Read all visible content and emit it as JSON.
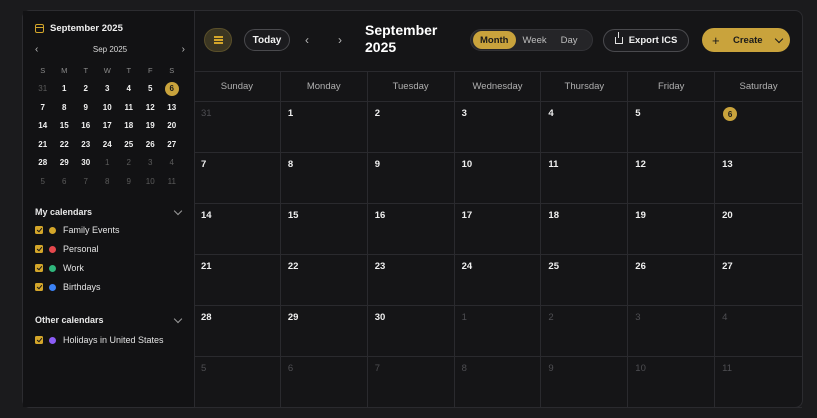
{
  "mini_calendar": {
    "title": "September 2025",
    "nav_label": "Sep 2025",
    "prev_icon": "‹",
    "next_icon": "›",
    "weekdays": [
      "S",
      "M",
      "T",
      "W",
      "T",
      "F",
      "S"
    ],
    "days": [
      {
        "d": "31",
        "out": true
      },
      {
        "d": "1"
      },
      {
        "d": "2"
      },
      {
        "d": "3"
      },
      {
        "d": "4"
      },
      {
        "d": "5"
      },
      {
        "d": "6",
        "today": true
      },
      {
        "d": "7"
      },
      {
        "d": "8"
      },
      {
        "d": "9"
      },
      {
        "d": "10"
      },
      {
        "d": "11"
      },
      {
        "d": "12"
      },
      {
        "d": "13"
      },
      {
        "d": "14"
      },
      {
        "d": "15"
      },
      {
        "d": "16"
      },
      {
        "d": "17"
      },
      {
        "d": "18"
      },
      {
        "d": "19"
      },
      {
        "d": "20"
      },
      {
        "d": "21"
      },
      {
        "d": "22"
      },
      {
        "d": "23"
      },
      {
        "d": "24"
      },
      {
        "d": "25"
      },
      {
        "d": "26"
      },
      {
        "d": "27"
      },
      {
        "d": "28"
      },
      {
        "d": "29"
      },
      {
        "d": "30"
      },
      {
        "d": "1",
        "out": true
      },
      {
        "d": "2",
        "out": true
      },
      {
        "d": "3",
        "out": true
      },
      {
        "d": "4",
        "out": true
      },
      {
        "d": "5",
        "out": true
      },
      {
        "d": "6",
        "out": true
      },
      {
        "d": "7",
        "out": true
      },
      {
        "d": "8",
        "out": true
      },
      {
        "d": "9",
        "out": true
      },
      {
        "d": "10",
        "out": true
      },
      {
        "d": "11",
        "out": true
      }
    ]
  },
  "my_calendars": {
    "heading": "My calendars",
    "items": [
      {
        "label": "Family Events",
        "color": "#d4a62a"
      },
      {
        "label": "Personal",
        "color": "#e5484d"
      },
      {
        "label": "Work",
        "color": "#2fb67c"
      },
      {
        "label": "Birthdays",
        "color": "#3b82f6"
      }
    ]
  },
  "other_calendars": {
    "heading": "Other calendars",
    "items": [
      {
        "label": "Holidays in United States",
        "color": "#8b5cf6"
      }
    ]
  },
  "toolbar": {
    "today_label": "Today",
    "prev_icon": "‹",
    "next_icon": "›",
    "title_month": "September",
    "title_year": "2025",
    "views": [
      "Month",
      "Week",
      "Day"
    ],
    "active_view": "Month",
    "export_label": "Export ICS",
    "create_label": "Create",
    "create_plus": "+"
  },
  "month_grid": {
    "weekdays": [
      "Sunday",
      "Monday",
      "Tuesday",
      "Wednesday",
      "Thursday",
      "Friday",
      "Saturday"
    ],
    "days": [
      {
        "d": "31",
        "out": true
      },
      {
        "d": "1"
      },
      {
        "d": "2"
      },
      {
        "d": "3"
      },
      {
        "d": "4"
      },
      {
        "d": "5"
      },
      {
        "d": "6",
        "today": true
      },
      {
        "d": "7"
      },
      {
        "d": "8"
      },
      {
        "d": "9"
      },
      {
        "d": "10"
      },
      {
        "d": "11"
      },
      {
        "d": "12"
      },
      {
        "d": "13"
      },
      {
        "d": "14"
      },
      {
        "d": "15"
      },
      {
        "d": "16"
      },
      {
        "d": "17"
      },
      {
        "d": "18"
      },
      {
        "d": "19"
      },
      {
        "d": "20"
      },
      {
        "d": "21"
      },
      {
        "d": "22"
      },
      {
        "d": "23"
      },
      {
        "d": "24"
      },
      {
        "d": "25"
      },
      {
        "d": "26"
      },
      {
        "d": "27"
      },
      {
        "d": "28"
      },
      {
        "d": "29"
      },
      {
        "d": "30"
      },
      {
        "d": "1",
        "out": true
      },
      {
        "d": "2",
        "out": true
      },
      {
        "d": "3",
        "out": true
      },
      {
        "d": "4",
        "out": true
      },
      {
        "d": "5",
        "out": true
      },
      {
        "d": "6",
        "out": true
      },
      {
        "d": "7",
        "out": true
      },
      {
        "d": "8",
        "out": true
      },
      {
        "d": "9",
        "out": true
      },
      {
        "d": "10",
        "out": true
      },
      {
        "d": "11",
        "out": true
      }
    ]
  },
  "colors": {
    "accent": "#c9a33c",
    "background": "#151517"
  }
}
